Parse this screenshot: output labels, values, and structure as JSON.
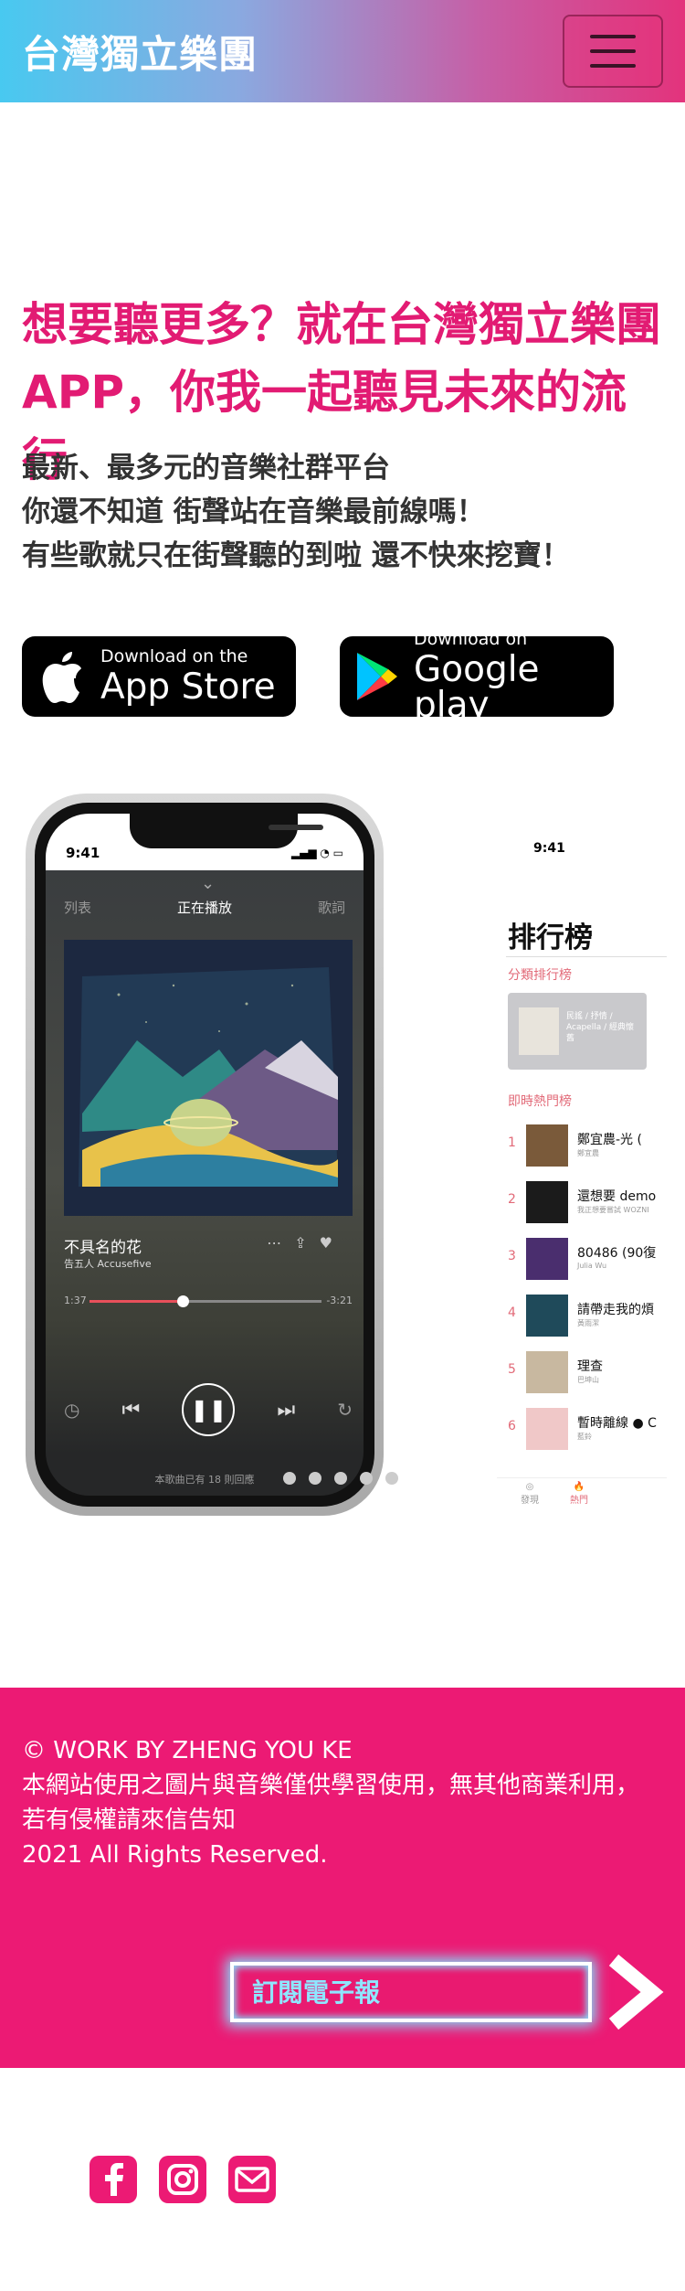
{
  "header": {
    "brand": "台灣獨立樂團",
    "menu_icon": "hamburger-icon"
  },
  "hero": {
    "title_line1": "想要聽更多？就在台灣獨立樂團",
    "title_line2": "APP，你我一起聽見未來的流行",
    "desc_line1": "最新、最多元的音樂社群平台",
    "desc_line2": "你還不知道 街聲站在音樂最前線嗎！",
    "desc_line3": "有些歌就只在街聲聽的到啦 還不快來挖寶！"
  },
  "badges": {
    "apple": {
      "small": "Download on the",
      "big": "App Store",
      "icon": "apple-icon"
    },
    "google": {
      "small": "Download on",
      "big": "Google play",
      "icon": "google-play-icon"
    }
  },
  "player": {
    "time": "9:41",
    "tabs": [
      "列表",
      "正在播放",
      "歌詞"
    ],
    "song_title": "不具名的花",
    "song_artist": "告五人 Accusefive",
    "elapsed": "1:37",
    "remaining": "-3:21",
    "progress": 0.4,
    "comment_note": "本歌曲已有 18 則回應"
  },
  "charts_screen": {
    "time": "9:41",
    "title": "排行榜",
    "section1": "分類排行榜",
    "card_text": "民謠 / 抒情 / Acapella / 經典懷舊",
    "section2": "即時熱門榜",
    "rows": [
      {
        "num": "1",
        "title": "鄭宜農-光 (",
        "artist": "鄭宜農"
      },
      {
        "num": "2",
        "title": "還想要 demo",
        "artist": "我正想要嘗試 WOZNI"
      },
      {
        "num": "3",
        "title": "80486 (90復",
        "artist": "Julia Wu"
      },
      {
        "num": "4",
        "title": "請帶走我的煩",
        "artist": "黃雨潔"
      },
      {
        "num": "5",
        "title": "理查",
        "artist": "巴坤山"
      },
      {
        "num": "6",
        "title": "暫時離線 ● C",
        "artist": "藍鈴"
      }
    ],
    "tabs": [
      "發現",
      "熱門"
    ]
  },
  "carousel": {
    "dot_count": 5
  },
  "footer": {
    "line1": "© WORK BY ZHENG YOU KE",
    "line2": "本網站使用之圖片與音樂僅供學習使用，無其他商業利用，若有侵權請來信告知",
    "line3": "2021 All Rights Reserved.",
    "subscribe_placeholder": "訂閱電子報",
    "submit_icon": "arrow-right-icon"
  },
  "social": [
    "facebook-icon",
    "instagram-icon",
    "mail-icon"
  ],
  "colors": {
    "accent": "#e21b73",
    "footer_bg": "#ec1a74",
    "header_start": "#48c9f0"
  }
}
